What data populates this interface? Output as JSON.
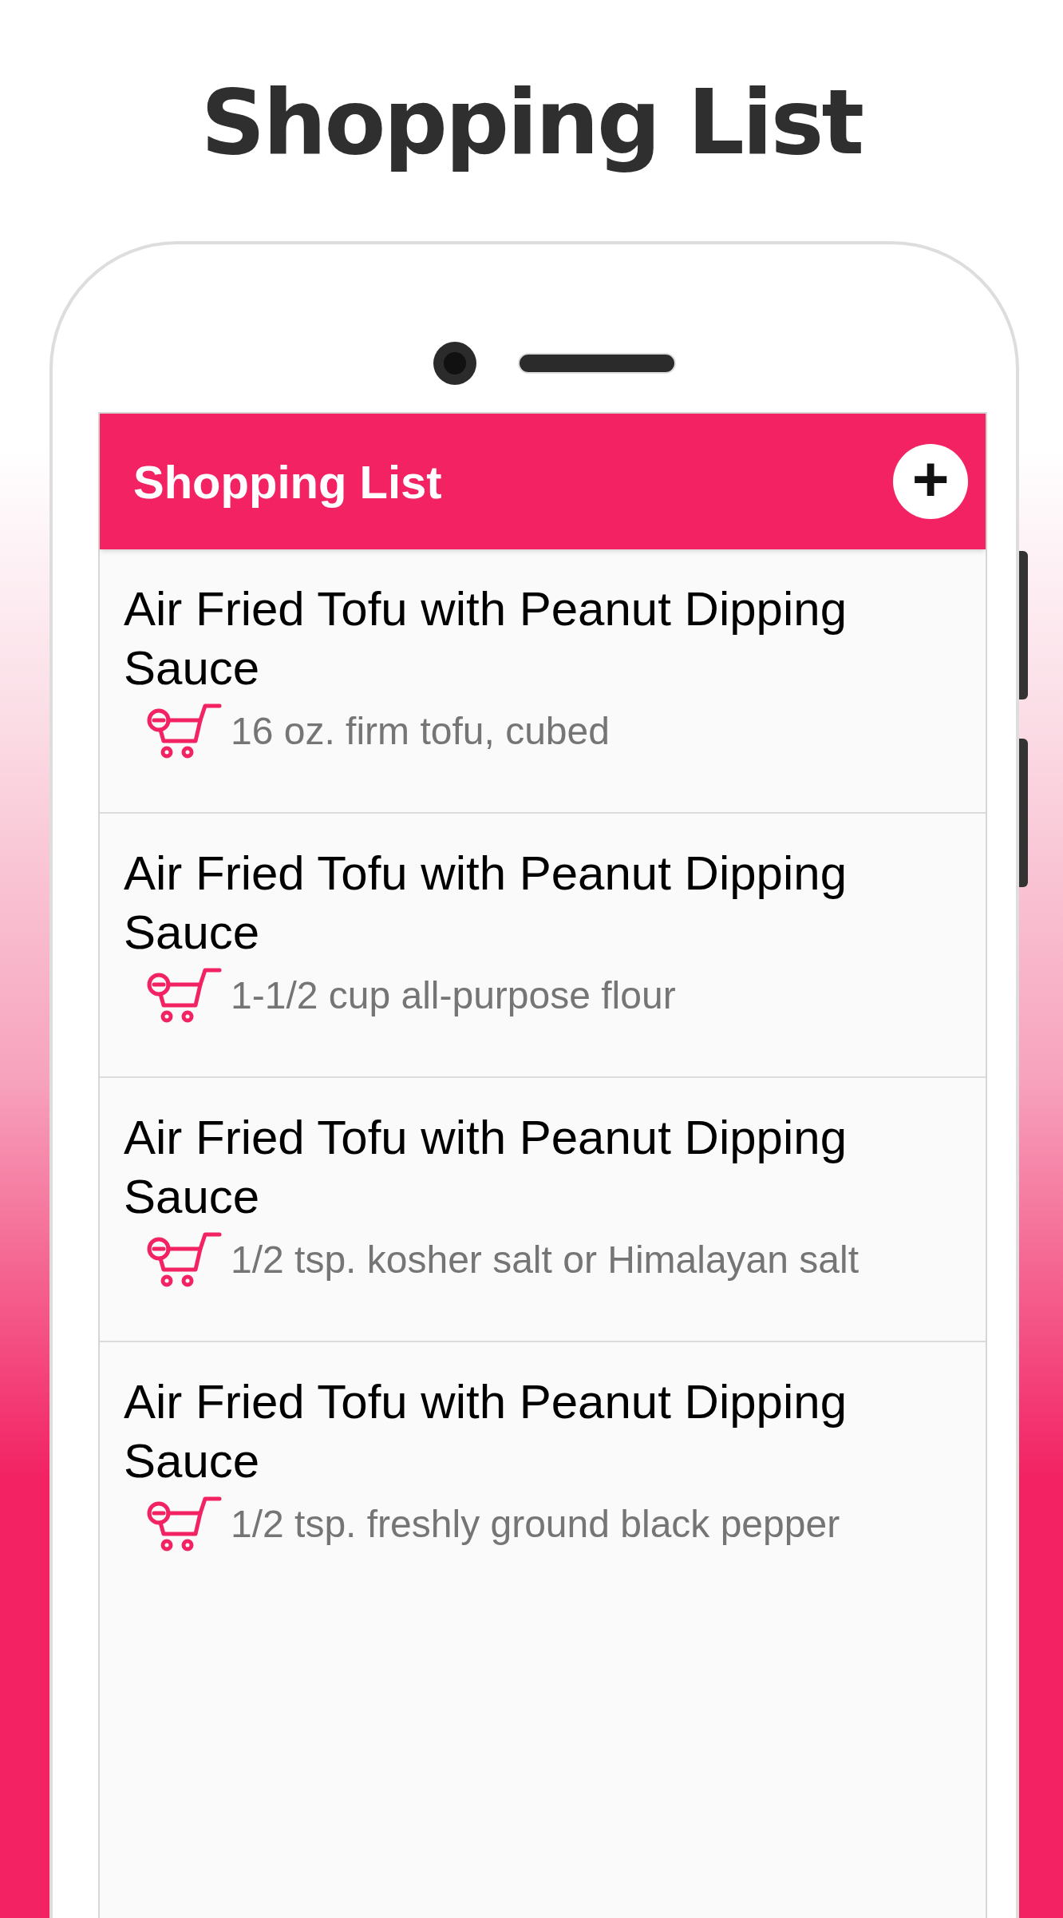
{
  "headline": "Shopping List",
  "app_bar": {
    "title": "Shopping List",
    "action": "+"
  },
  "items": [
    {
      "recipe": "Air Fried Tofu with Peanut Dipping Sauce",
      "ingredient": "16 oz. firm tofu, cubed"
    },
    {
      "recipe": "Air Fried Tofu with Peanut Dipping Sauce",
      "ingredient": "1-1/2 cup all-purpose flour"
    },
    {
      "recipe": "Air Fried Tofu with Peanut Dipping Sauce",
      "ingredient": "1/2 tsp. kosher salt or Himalayan salt"
    },
    {
      "recipe": "Air Fried Tofu with Peanut Dipping Sauce",
      "ingredient": "1/2 tsp. freshly ground black pepper"
    }
  ]
}
